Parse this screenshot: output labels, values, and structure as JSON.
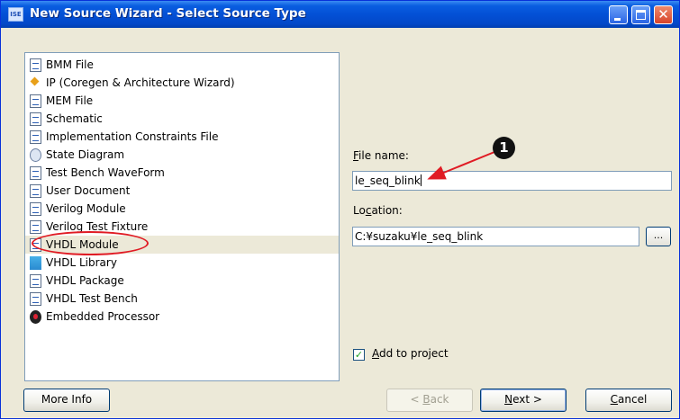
{
  "window": {
    "title": "New Source Wizard - Select Source Type",
    "icon_text": "ISE"
  },
  "source_types": [
    {
      "label": "BMM File",
      "icon": "bmm-file-icon"
    },
    {
      "label": "IP (Coregen & Architecture Wizard)",
      "icon": "ip-core-icon"
    },
    {
      "label": "MEM File",
      "icon": "mem-file-icon"
    },
    {
      "label": "Schematic",
      "icon": "schematic-icon"
    },
    {
      "label": "Implementation Constraints File",
      "icon": "constraints-file-icon"
    },
    {
      "label": "State Diagram",
      "icon": "state-diagram-icon"
    },
    {
      "label": "Test Bench WaveForm",
      "icon": "waveform-icon"
    },
    {
      "label": "User Document",
      "icon": "document-icon"
    },
    {
      "label": "Verilog Module",
      "icon": "verilog-module-icon"
    },
    {
      "label": "Verilog Test Fixture",
      "icon": "verilog-fixture-icon"
    },
    {
      "label": "VHDL Module",
      "icon": "vhdl-module-icon",
      "selected": true
    },
    {
      "label": "VHDL Library",
      "icon": "library-icon"
    },
    {
      "label": "VHDL Package",
      "icon": "vhdl-package-icon"
    },
    {
      "label": "VHDL Test Bench",
      "icon": "vhdl-testbench-icon"
    },
    {
      "label": "Embedded Processor",
      "icon": "embedded-processor-icon"
    }
  ],
  "file_name": {
    "label_prefix": "F",
    "label_rest": "ile name:",
    "value": "le_seq_blink"
  },
  "location": {
    "label_prefix": "Lo",
    "label_u": "c",
    "label_rest": "ation:",
    "value": "C:¥suzaku¥le_seq_blink",
    "browse_label": "..."
  },
  "add_to_project": {
    "label_u": "A",
    "label_rest": "dd to project",
    "checked": true,
    "check_mark": "✓"
  },
  "buttons": {
    "more_info": "More Info",
    "back_prefix": "< ",
    "back_u": "B",
    "back_rest": "ack",
    "next_u": "N",
    "next_rest": "ext >",
    "cancel_u": "C",
    "cancel_rest": "ancel"
  },
  "annotation": {
    "marker": "1",
    "color": "#e01b24"
  },
  "colors": {
    "titlebar": "#0350d6",
    "dialog_bg": "#ece9d8",
    "selection_bg": "#ece9d8",
    "annotation_red": "#e01b24"
  }
}
